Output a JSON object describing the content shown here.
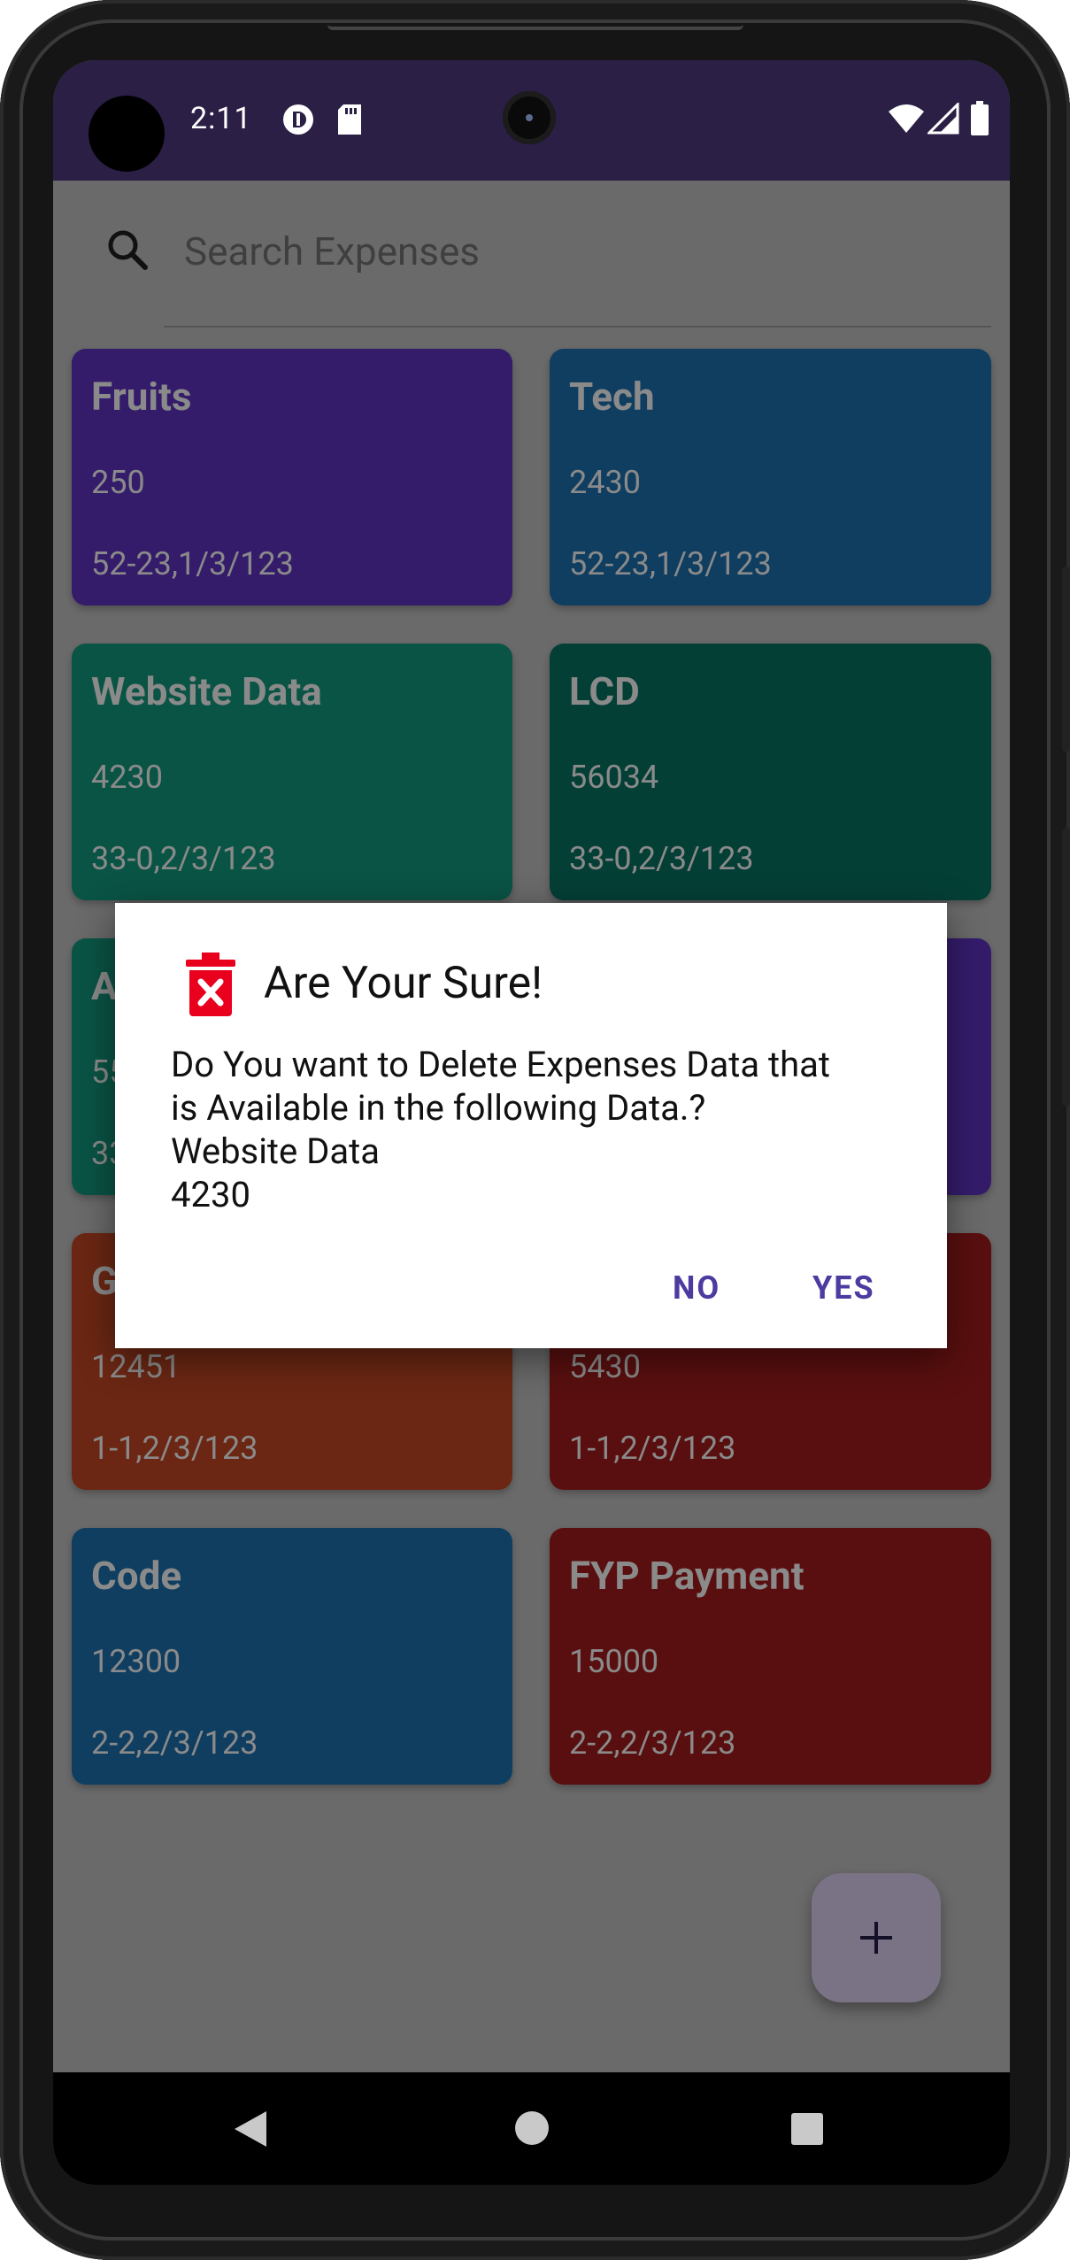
{
  "status_bar": {
    "time": "2:11"
  },
  "search": {
    "placeholder": "Search Expenses"
  },
  "expenses": [
    {
      "title": "Fruits",
      "amount": "250",
      "date": "52-23,1/3/123",
      "color": "#341c6b"
    },
    {
      "title": "Tech",
      "amount": "2430",
      "date": "52-23,1/3/123",
      "color": "#0f3e61"
    },
    {
      "title": "Website Data",
      "amount": "4230",
      "date": "33-0,2/3/123",
      "color": "#0a5445"
    },
    {
      "title": "LCD",
      "amount": "56034",
      "date": "33-0,2/3/123",
      "color": "#043f36"
    },
    {
      "title": "A",
      "amount": "55",
      "date": "33",
      "color": "#0a5445"
    },
    {
      "title": "",
      "amount": "",
      "date": "",
      "color": "#341c6b"
    },
    {
      "title": "G",
      "amount": "12451",
      "date": "1-1,2/3/123",
      "color": "#6b2713"
    },
    {
      "title": "",
      "amount": "5430",
      "date": "1-1,2/3/123",
      "color": "#590f0f"
    },
    {
      "title": "Code",
      "amount": "12300",
      "date": "2-2,2/3/123",
      "color": "#0f3e61"
    },
    {
      "title": "FYP Payment",
      "amount": "15000",
      "date": "2-2,2/3/123",
      "color": "#590f0f"
    }
  ],
  "fab": {
    "icon": "plus-icon"
  },
  "dialog": {
    "icon": "delete-icon",
    "title": "Are Your Sure!",
    "message": "Do You want to Delete Expenses Data that\nis Available in the following Data.?\nWebsite Data\n4230",
    "no_label": "NO",
    "yes_label": "YES",
    "accent_color": "#4d3ba0",
    "icon_color": "#e8001c"
  },
  "nav": {
    "back": "back-icon",
    "home": "home-icon",
    "recents": "recents-icon"
  }
}
